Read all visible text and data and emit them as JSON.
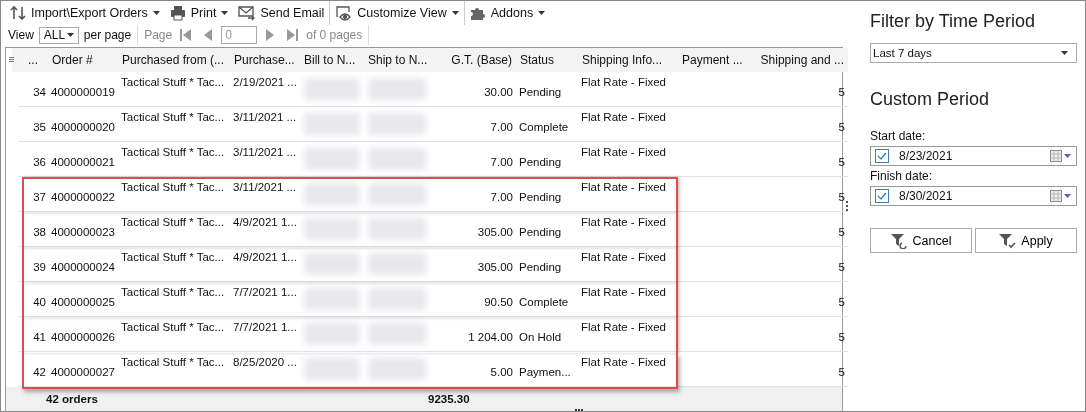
{
  "toolbar": [
    {
      "kind": "import",
      "label": "Import\\Export Orders",
      "has_menu": true
    },
    {
      "kind": "print",
      "label": "Print",
      "has_menu": true
    },
    {
      "kind": "email",
      "label": "Send Email",
      "has_menu": false
    },
    {
      "kind": "view",
      "label": "Customize View",
      "has_menu": true
    },
    {
      "kind": "addons",
      "label": "Addons",
      "has_menu": true
    }
  ],
  "pager": {
    "view_label": "View",
    "per_page_value": "ALL",
    "per_page_label": "per page",
    "page_label": "Page",
    "page_value": "0",
    "pages_label": "of 0 pages",
    "disabled": true
  },
  "table": {
    "columns": [
      {
        "label": "...",
        "kind": "number"
      },
      {
        "label": "Order #",
        "kind": "text"
      },
      {
        "label": "Purchased from (...",
        "kind": "top"
      },
      {
        "label": "Purchase...",
        "kind": "top"
      },
      {
        "label": "Bill to N...",
        "kind": "blurred"
      },
      {
        "label": "Ship to N...",
        "kind": "blurred"
      },
      {
        "label": "G.T. (Base)",
        "kind": "amount"
      },
      {
        "label": "Status",
        "kind": "text"
      },
      {
        "label": "Shipping Info...",
        "kind": "top"
      },
      {
        "label": "Payment ...",
        "kind": "text"
      },
      {
        "label": "Shipping and ...",
        "kind": "amount"
      }
    ],
    "rows": [
      {
        "highlighted": false,
        "cells": [
          "34",
          "4000000019",
          "Tactical Stuff * Tac...",
          "2/19/2021 ...",
          "",
          "",
          "30.00",
          "Pending",
          "Flat Rate - Fixed",
          "",
          "5"
        ]
      },
      {
        "highlighted": false,
        "cells": [
          "35",
          "4000000020",
          "Tactical Stuff * Tac...",
          "3/11/2021 ...",
          "",
          "",
          "7.00",
          "Complete",
          "Flat Rate - Fixed",
          "",
          "5"
        ]
      },
      {
        "highlighted": false,
        "cells": [
          "36",
          "4000000021",
          "Tactical Stuff * Tac...",
          "3/11/2021 ...",
          "",
          "",
          "7.00",
          "Pending",
          "Flat Rate - Fixed",
          "",
          "5"
        ]
      },
      {
        "highlighted": true,
        "cells": [
          "37",
          "4000000022",
          "Tactical Stuff * Tac...",
          "3/11/2021 ...",
          "",
          "",
          "7.00",
          "Pending",
          "Flat Rate - Fixed",
          "",
          "5"
        ]
      },
      {
        "highlighted": true,
        "cells": [
          "38",
          "4000000023",
          "Tactical Stuff * Tac...",
          "4/9/2021 1...",
          "",
          "",
          "305.00",
          "Pending",
          "Flat Rate - Fixed",
          "",
          "5"
        ]
      },
      {
        "highlighted": true,
        "cells": [
          "39",
          "4000000024",
          "Tactical Stuff * Tac...",
          "4/9/2021 1...",
          "",
          "",
          "305.00",
          "Pending",
          "Flat Rate - Fixed",
          "",
          "5"
        ]
      },
      {
        "highlighted": true,
        "cells": [
          "40",
          "4000000025",
          "Tactical Stuff * Tac...",
          "7/7/2021 1...",
          "",
          "",
          "90.50",
          "Complete",
          "Flat Rate - Fixed",
          "",
          "5"
        ]
      },
      {
        "highlighted": true,
        "cells": [
          "41",
          "4000000026",
          "Tactical Stuff * Tac...",
          "7/7/2021 1...",
          "",
          "",
          "1 204.00",
          "On Hold",
          "Flat Rate - Fixed",
          "",
          "5"
        ]
      },
      {
        "highlighted": true,
        "cells": [
          "42",
          "4000000027",
          "Tactical Stuff * Tac...",
          "8/25/2020 ...",
          "",
          "",
          "5.00",
          "Paymen...",
          "Flat Rate - Fixed",
          "",
          "5"
        ]
      }
    ],
    "footer": {
      "order_count": "42 orders",
      "grand_total": "9235.30"
    }
  },
  "filter_panel": {
    "title": "Filter by Time Period",
    "period": "Last 7 days",
    "custom_title": "Custom Period",
    "dates": [
      {
        "label": "Start date:",
        "value": "8/23/2021",
        "checked": true
      },
      {
        "label": "Finish date:",
        "value": "8/30/2021",
        "checked": true
      }
    ],
    "buttons": [
      {
        "kind": "cancel",
        "label": "Cancel"
      },
      {
        "kind": "apply",
        "label": "Apply"
      }
    ]
  }
}
